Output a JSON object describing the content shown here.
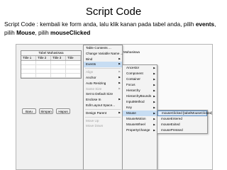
{
  "slide": {
    "title": "Script Code",
    "instruction_prefix": "Script Code : kembali ke form anda, lalu klik kanan pada tabel anda, pilih",
    "instruction_events": "events",
    "instruction_sep1": ", pilih",
    "instruction_mouse": "Mouse",
    "instruction_sep2": ", pilih",
    "instruction_clicked": "mouseClicked"
  },
  "form": {
    "table_caption": "Tabel Mahasiswa",
    "columns": [
      "Title 1",
      "Title 2",
      "Title 3",
      "Title"
    ],
    "buttons": [
      "Baru",
      "Simpan",
      "Hapus"
    ]
  },
  "panel": {
    "label": "Mahasiswa"
  },
  "context_menu": {
    "items": [
      {
        "label": "Table Contents ...",
        "disabled": false,
        "arrow": false
      },
      {
        "label": "Change Variable Name ...",
        "disabled": false,
        "arrow": false
      },
      {
        "label": "Bind",
        "disabled": false,
        "arrow": true
      },
      {
        "label": "Events",
        "disabled": false,
        "arrow": true,
        "active": true
      },
      {
        "sep": true
      },
      {
        "label": "Align",
        "disabled": true,
        "arrow": true
      },
      {
        "label": "Anchor",
        "disabled": false,
        "arrow": true
      },
      {
        "label": "Auto Resizing",
        "disabled": false,
        "arrow": true
      },
      {
        "label": "Same Size",
        "disabled": true,
        "arrow": true
      },
      {
        "label": "Set to Default Size",
        "disabled": false,
        "arrow": false
      },
      {
        "label": "Enclose In",
        "disabled": false,
        "arrow": true
      },
      {
        "label": "Edit Layout Space...",
        "disabled": false,
        "arrow": false
      },
      {
        "sep": true
      },
      {
        "label": "Design Parent",
        "disabled": false,
        "arrow": true
      },
      {
        "sep": true
      },
      {
        "label": "Move Up",
        "disabled": true,
        "arrow": false
      },
      {
        "label": "Move Down",
        "disabled": true,
        "arrow": false
      }
    ]
  },
  "events_menu": {
    "items": [
      "Ancestor",
      "Component",
      "Container",
      "Focus",
      "Hierarchy",
      "HierarchyBounds",
      "InputMethod",
      "Key",
      "Mouse",
      "MouseMotion",
      "MouseWheel",
      "PropertyChange"
    ],
    "active": "Mouse"
  },
  "mouse_menu": {
    "items": [
      "mouseClicked [tabelMouseClicked]",
      "mouseEntered",
      "mouseExited",
      "mousePressed"
    ],
    "selected": "mouseClicked [tabelMouseClicked]"
  }
}
